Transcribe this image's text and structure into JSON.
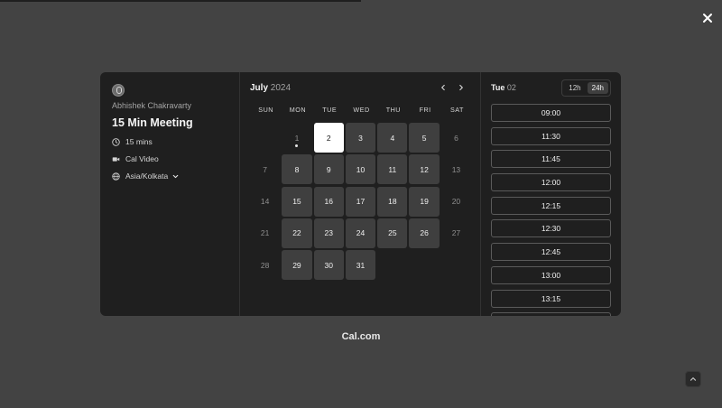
{
  "event": {
    "owner": "Abhishek Chakravarty",
    "title": "15 Min Meeting",
    "duration": "15 mins",
    "location": "Cal Video",
    "timezone": "Asia/Kolkata"
  },
  "calendar": {
    "month": "July",
    "year": "2024",
    "weekdays": [
      "SUN",
      "MON",
      "TUE",
      "WED",
      "THU",
      "FRI",
      "SAT"
    ],
    "days": [
      {
        "label": "",
        "state": "blank"
      },
      {
        "label": "1",
        "state": "today"
      },
      {
        "label": "2",
        "state": "selected"
      },
      {
        "label": "3",
        "state": "available"
      },
      {
        "label": "4",
        "state": "available"
      },
      {
        "label": "5",
        "state": "available"
      },
      {
        "label": "6",
        "state": "muted"
      },
      {
        "label": "7",
        "state": "muted"
      },
      {
        "label": "8",
        "state": "available"
      },
      {
        "label": "9",
        "state": "available"
      },
      {
        "label": "10",
        "state": "available"
      },
      {
        "label": "11",
        "state": "available"
      },
      {
        "label": "12",
        "state": "available"
      },
      {
        "label": "13",
        "state": "muted"
      },
      {
        "label": "14",
        "state": "muted"
      },
      {
        "label": "15",
        "state": "available"
      },
      {
        "label": "16",
        "state": "available"
      },
      {
        "label": "17",
        "state": "available"
      },
      {
        "label": "18",
        "state": "available"
      },
      {
        "label": "19",
        "state": "available"
      },
      {
        "label": "20",
        "state": "muted"
      },
      {
        "label": "21",
        "state": "muted"
      },
      {
        "label": "22",
        "state": "available"
      },
      {
        "label": "23",
        "state": "available"
      },
      {
        "label": "24",
        "state": "available"
      },
      {
        "label": "25",
        "state": "available"
      },
      {
        "label": "26",
        "state": "available"
      },
      {
        "label": "27",
        "state": "muted"
      },
      {
        "label": "28",
        "state": "muted"
      },
      {
        "label": "29",
        "state": "available"
      },
      {
        "label": "30",
        "state": "available"
      },
      {
        "label": "31",
        "state": "available"
      }
    ]
  },
  "slots": {
    "day": "Tue",
    "date": "02",
    "format_12h": "12h",
    "format_24h": "24h",
    "times": [
      "09:00",
      "11:30",
      "11:45",
      "12:00",
      "12:15",
      "12:30",
      "12:45",
      "13:00",
      "13:15"
    ]
  },
  "brand": "Cal.com",
  "colors": {
    "overlay": "#434343",
    "panel": "#1f1f1f",
    "available_day": "#3f3f3f",
    "selected_day": "#ffffff"
  }
}
